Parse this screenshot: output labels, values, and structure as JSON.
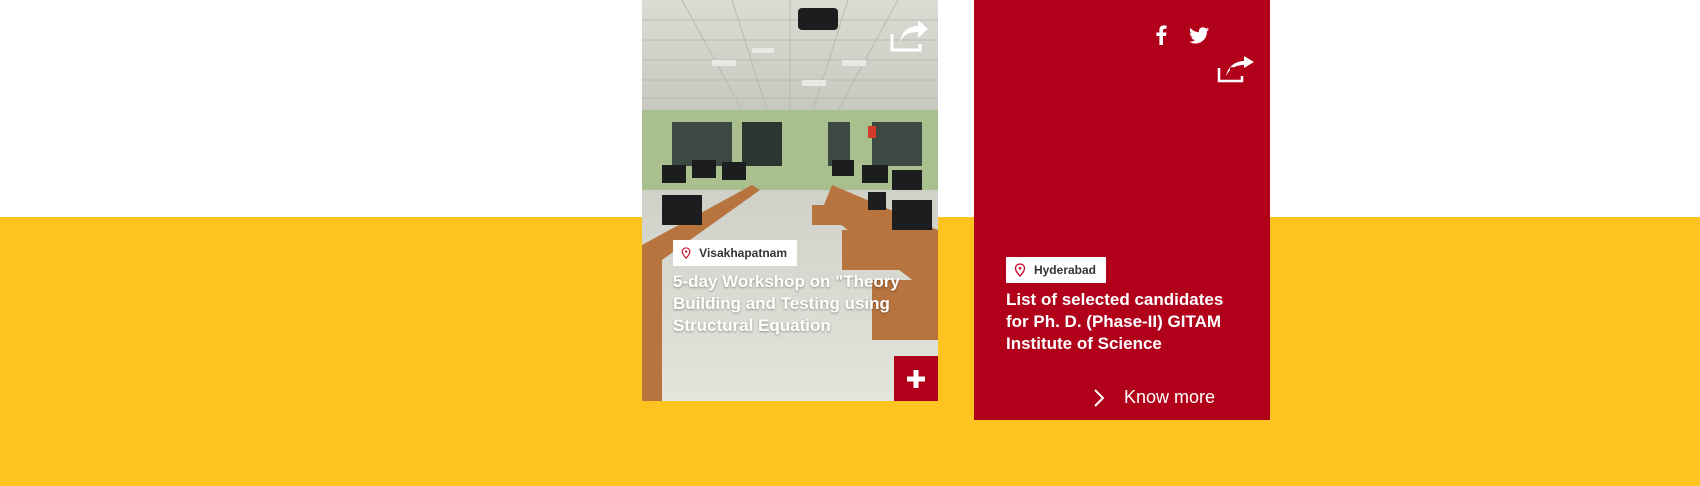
{
  "colors": {
    "band": "#fdc31f",
    "brand_red": "#b1001a",
    "white": "#ffffff"
  },
  "card_photo": {
    "location": "Visakhapatnam",
    "title": "5-day Workshop on \"Theory Building and Testing using Structural Equation",
    "icons": [
      "share-icon",
      "location-pin-icon",
      "plus-icon"
    ]
  },
  "card_red": {
    "location": "Hyderabad",
    "title": "List of selected candidates for Ph. D. (Phase-II) GITAM Institute of Science",
    "know_more_label": "Know more",
    "icons": [
      "facebook-icon",
      "twitter-icon",
      "share-icon",
      "location-pin-icon",
      "chevron-right-icon"
    ]
  }
}
